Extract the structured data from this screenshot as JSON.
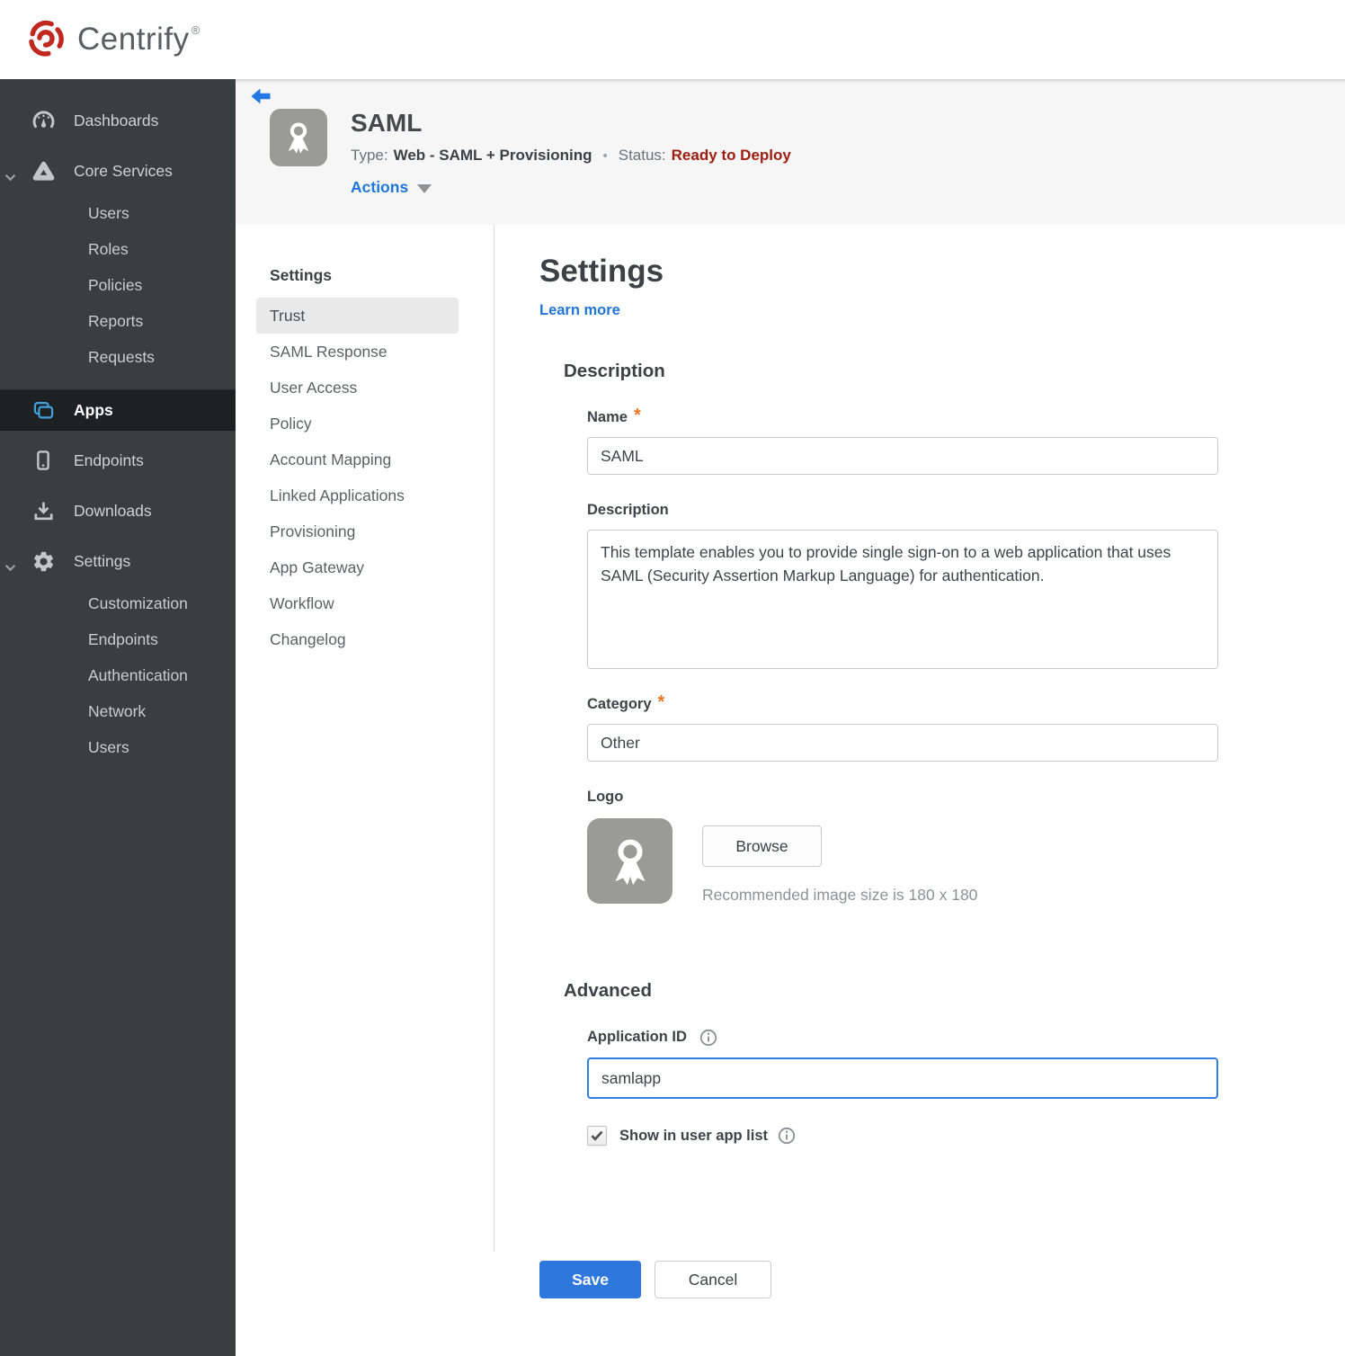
{
  "brand": {
    "name": "Centrify",
    "registered": "®"
  },
  "sidebar": {
    "items": [
      {
        "label": "Dashboards",
        "icon": "gauge-icon"
      },
      {
        "label": "Core Services",
        "icon": "core-services-icon",
        "expanded": true,
        "children": [
          "Users",
          "Roles",
          "Policies",
          "Reports",
          "Requests"
        ]
      },
      {
        "label": "Apps",
        "icon": "apps-icon",
        "selected": true
      },
      {
        "label": "Endpoints",
        "icon": "device-icon"
      },
      {
        "label": "Downloads",
        "icon": "download-icon"
      },
      {
        "label": "Settings",
        "icon": "gear-icon",
        "expanded": true,
        "children": [
          "Customization",
          "Endpoints",
          "Authentication",
          "Network",
          "Users"
        ]
      }
    ]
  },
  "app_header": {
    "title": "SAML",
    "type_label": "Type:",
    "type_value": "Web - SAML + Provisioning",
    "separator": "•",
    "status_label": "Status:",
    "status_value": "Ready to Deploy",
    "actions_label": "Actions",
    "app_icon": "award-ribbon-icon"
  },
  "subnav": {
    "header": "Settings",
    "selected": "Trust",
    "items": [
      "Trust",
      "SAML Response",
      "User Access",
      "Policy",
      "Account Mapping",
      "Linked Applications",
      "Provisioning",
      "App Gateway",
      "Workflow",
      "Changelog"
    ]
  },
  "main": {
    "title": "Settings",
    "learn_more": "Learn more",
    "required_marker": "*",
    "description_section": {
      "heading": "Description",
      "name_label": "Name",
      "name_value": "SAML",
      "description_label": "Description",
      "description_value": "This template enables you to provide single sign-on to a web application that uses SAML (Security Assertion Markup Language) for authentication.",
      "category_label": "Category",
      "category_value": "Other",
      "logo_label": "Logo",
      "logo_icon": "award-ribbon-icon",
      "browse_label": "Browse",
      "logo_hint": "Recommended image size is 180 x 180"
    },
    "advanced_section": {
      "heading": "Advanced",
      "application_id_label": "Application ID",
      "application_id_value": "samlapp",
      "show_in_user_app_list_label": "Show in user app list",
      "show_in_user_app_list_checked": true
    },
    "footer": {
      "save_label": "Save",
      "cancel_label": "Cancel"
    }
  },
  "colors": {
    "brand_red": "#c0271e",
    "sidebar_bg": "#3a3e3e",
    "sidebar_selected_bg": "#1d2121",
    "apps_icon_blue": "#41a0dd",
    "link_blue": "#2077d8",
    "save_blue": "#2e78dd",
    "focus_blue": "#2e7fe0",
    "status_red": "#9e1c10",
    "asterisk_orange": "#e87722",
    "band_gray": "#f6f6f6"
  }
}
